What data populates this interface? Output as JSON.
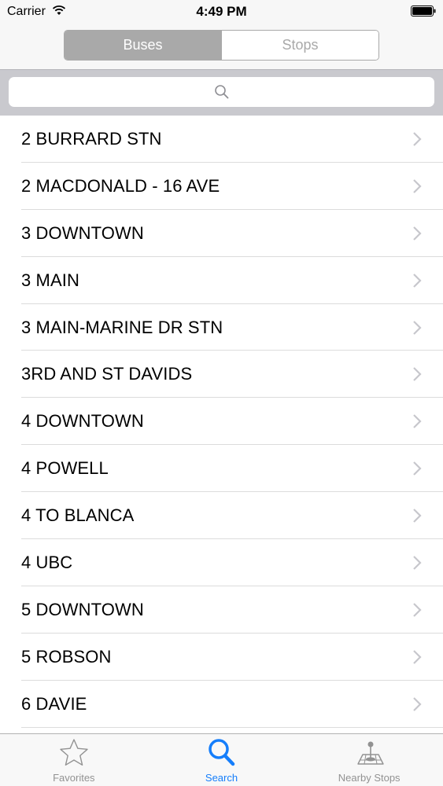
{
  "status_bar": {
    "carrier": "Carrier",
    "time": "4:49 PM"
  },
  "segmented_control": {
    "segments": [
      {
        "label": "Buses",
        "selected": true
      },
      {
        "label": "Stops",
        "selected": false
      }
    ]
  },
  "search": {
    "value": "",
    "placeholder": ""
  },
  "list": {
    "items": [
      {
        "label": "2 BURRARD STN"
      },
      {
        "label": "2 MACDONALD - 16 AVE"
      },
      {
        "label": "3 DOWNTOWN"
      },
      {
        "label": "3 MAIN"
      },
      {
        "label": "3 MAIN-MARINE DR STN"
      },
      {
        "label": "3RD AND ST DAVIDS"
      },
      {
        "label": "4 DOWNTOWN"
      },
      {
        "label": "4 POWELL"
      },
      {
        "label": "4 TO BLANCA"
      },
      {
        "label": "4 UBC"
      },
      {
        "label": "5 DOWNTOWN"
      },
      {
        "label": "5 ROBSON"
      },
      {
        "label": "6 DAVIE"
      }
    ]
  },
  "tab_bar": {
    "tabs": [
      {
        "label": "Favorites",
        "icon": "star-icon",
        "active": false
      },
      {
        "label": "Search",
        "icon": "magnifier-icon",
        "active": true
      },
      {
        "label": "Nearby Stops",
        "icon": "map-pin-icon",
        "active": false
      }
    ]
  },
  "colors": {
    "accent": "#157efb",
    "segment_selected": "#a9a9a9",
    "tab_inactive": "#929292"
  }
}
